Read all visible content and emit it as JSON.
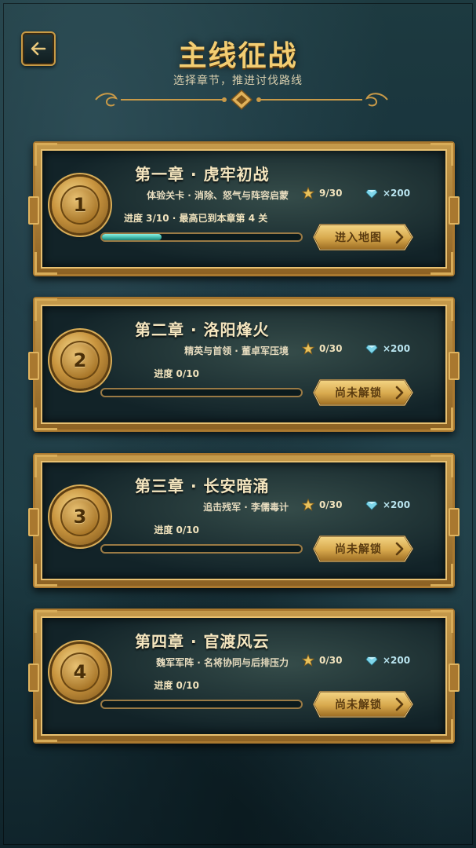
{
  "header": {
    "title": "主线征战",
    "subtitle": "选择章节，推进讨伐路线",
    "back_icon": "arrow-left-icon"
  },
  "colors": {
    "gold": "#f3cd72",
    "frame": "#a9782f",
    "progress": "#3eb7a8",
    "reward": "#b9e4ef"
  },
  "chapters": [
    {
      "number": "1",
      "title": "第一章 · 虎牢初战",
      "desc": "体验关卡 · 消除、怒气与阵容启蒙",
      "stars": "9/30",
      "reward": "×200",
      "progress": "进度 3/10 · 最高已到本章第 4 关",
      "progress_fraction": 0.3,
      "button": "进入地图",
      "unlocked": true
    },
    {
      "number": "2",
      "title": "第二章 · 洛阳烽火",
      "desc": "精英与首领 · 董卓军压境",
      "stars": "0/30",
      "reward": "×200",
      "progress": "进度 0/10",
      "progress_fraction": 0,
      "button": "尚未解锁",
      "unlocked": false
    },
    {
      "number": "3",
      "title": "第三章 · 长安暗涌",
      "desc": "追击残军 · 李儒毒计",
      "stars": "0/30",
      "reward": "×200",
      "progress": "进度 0/10",
      "progress_fraction": 0,
      "button": "尚未解锁",
      "unlocked": false
    },
    {
      "number": "4",
      "title": "第四章 · 官渡风云",
      "desc": "魏军军阵 · 名将协同与后排压力",
      "stars": "0/30",
      "reward": "×200",
      "progress": "进度 0/10",
      "progress_fraction": 0,
      "button": "尚未解锁",
      "unlocked": false
    }
  ]
}
